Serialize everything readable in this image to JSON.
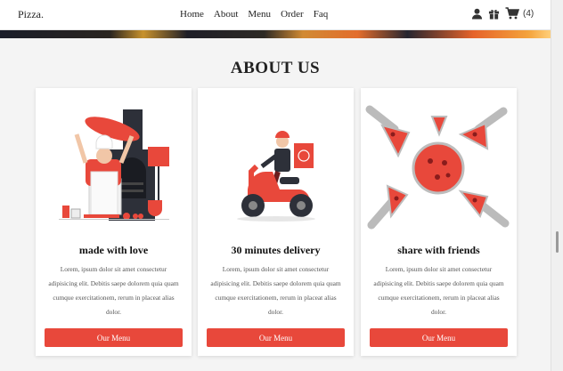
{
  "nav": {
    "brand": "Pizza.",
    "links": [
      "Home",
      "About",
      "Menu",
      "Order",
      "Faq"
    ],
    "cart_count": "(4)"
  },
  "section": {
    "title": "ABOUT US"
  },
  "cards": [
    {
      "title": "made with love",
      "text": "Lorem, ipsum dolor sit amet consectetur adipisicing elit. Debitis saepe dolorem quia quam cumque exercitationem, rerum in placeat alias dolor.",
      "button": "Our Menu",
      "illustration": "chef-tossing-pizza-illustration"
    },
    {
      "title": "30 minutes delivery",
      "text": "Lorem, ipsum dolor sit amet consectetur adipisicing elit. Debitis saepe dolorem quia quam cumque exercitationem, rerum in placeat alias dolor.",
      "button": "Our Menu",
      "illustration": "scooter-delivery-illustration"
    },
    {
      "title": "share with friends",
      "text": "Lorem, ipsum dolor sit amet consectetur adipisicing elit. Debitis saepe dolorem quia quam cumque exercitationem, rerum in placeat alias dolor.",
      "button": "Our Menu",
      "illustration": "sharing-pizza-slices-illustration"
    }
  ],
  "colors": {
    "accent": "#e8483b",
    "dark": "#2b2b35",
    "background": "#f4f4f4"
  }
}
